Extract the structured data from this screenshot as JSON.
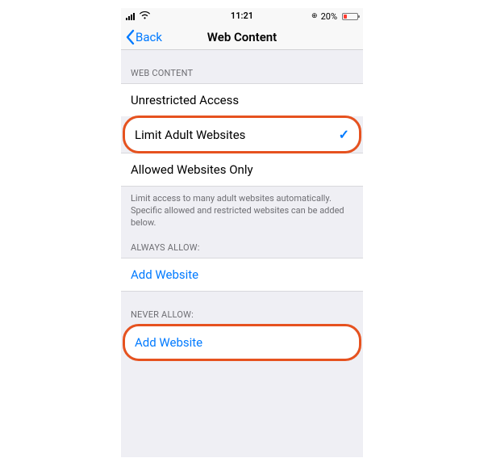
{
  "statusbar": {
    "time": "11:21",
    "battery_percent": "20%"
  },
  "nav": {
    "back_label": "Back",
    "title": "Web Content"
  },
  "sections": {
    "web_content_header": "WEB CONTENT",
    "always_allow_header": "ALWAYS ALLOW:",
    "never_allow_header": "NEVER ALLOW:"
  },
  "options": {
    "unrestricted": "Unrestricted Access",
    "limit_adult": "Limit Adult Websites",
    "allowed_only": "Allowed Websites Only"
  },
  "footer": "Limit access to many adult websites automatically. Specific allowed and restricted websites can be added below.",
  "links": {
    "add_website_always": "Add Website",
    "add_website_never": "Add Website"
  },
  "icons": {
    "checkmark": "✓"
  }
}
